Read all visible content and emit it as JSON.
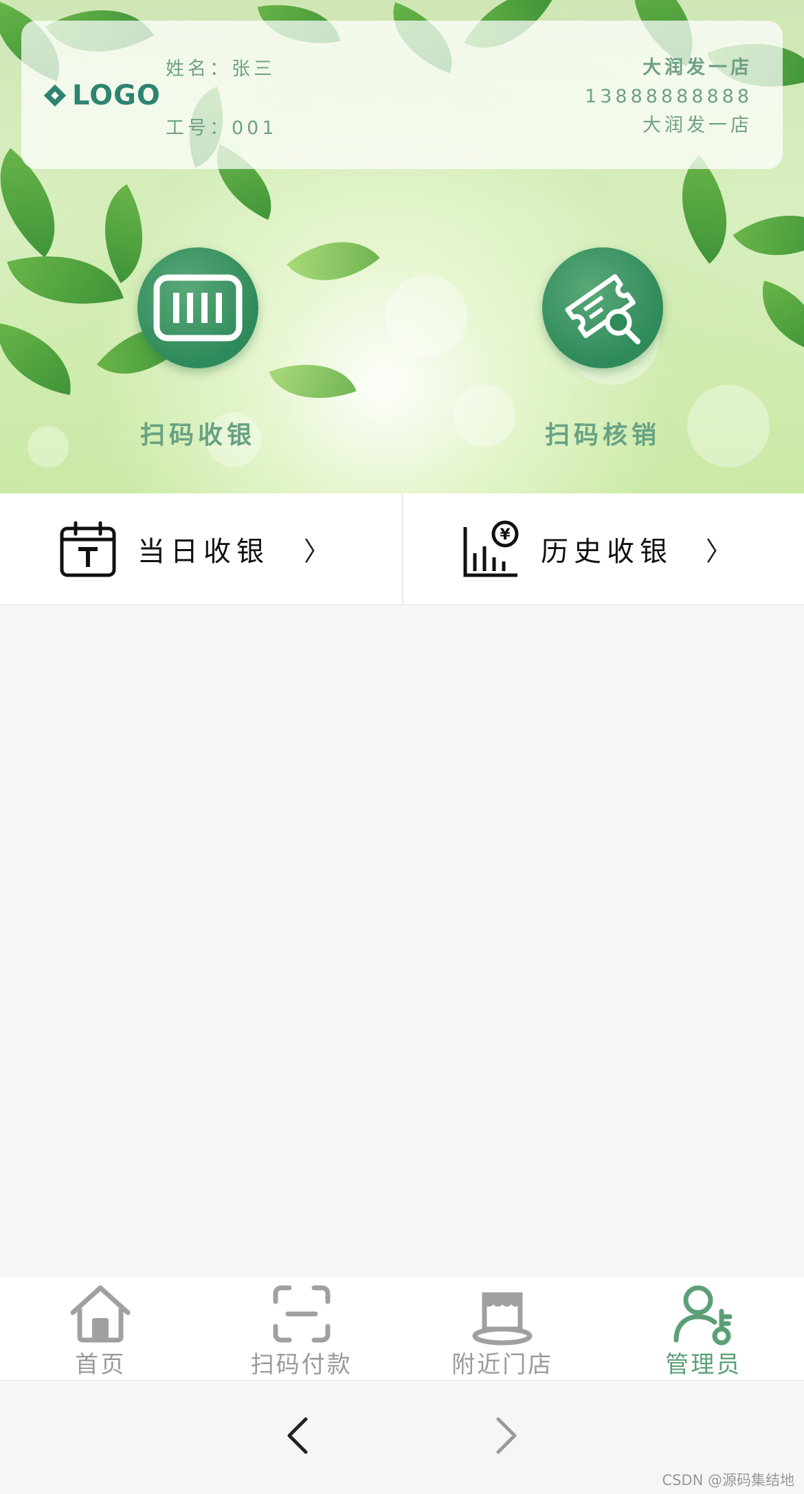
{
  "header": {
    "logo_text": "LOGO",
    "name_line": "姓名：张三",
    "employee_line": "工号：001",
    "store_name": "大润发一店",
    "phone": "13888888888",
    "store_sub": "大润发一店"
  },
  "actions": [
    {
      "label": "扫码收银",
      "icon": "barcode-icon"
    },
    {
      "label": "扫码核销",
      "icon": "ticket-search-icon"
    }
  ],
  "quick": [
    {
      "label": "当日收银",
      "icon": "calendar-today-icon",
      "arrow": "〉"
    },
    {
      "label": "历史收银",
      "icon": "yuan-chart-icon",
      "arrow": "〉"
    }
  ],
  "tabbar": {
    "items": [
      {
        "label": "首页",
        "icon": "home-icon"
      },
      {
        "label": "扫码付款",
        "icon": "scan-icon"
      },
      {
        "label": "附近门店",
        "icon": "store-icon"
      },
      {
        "label": "管理员",
        "icon": "admin-key-icon"
      }
    ],
    "active_index": 3
  },
  "colors": {
    "accent": "#5c9f76",
    "logo": "#2d8470",
    "inactive": "#9a9a9a"
  },
  "watermark": "CSDN @源码集结地"
}
